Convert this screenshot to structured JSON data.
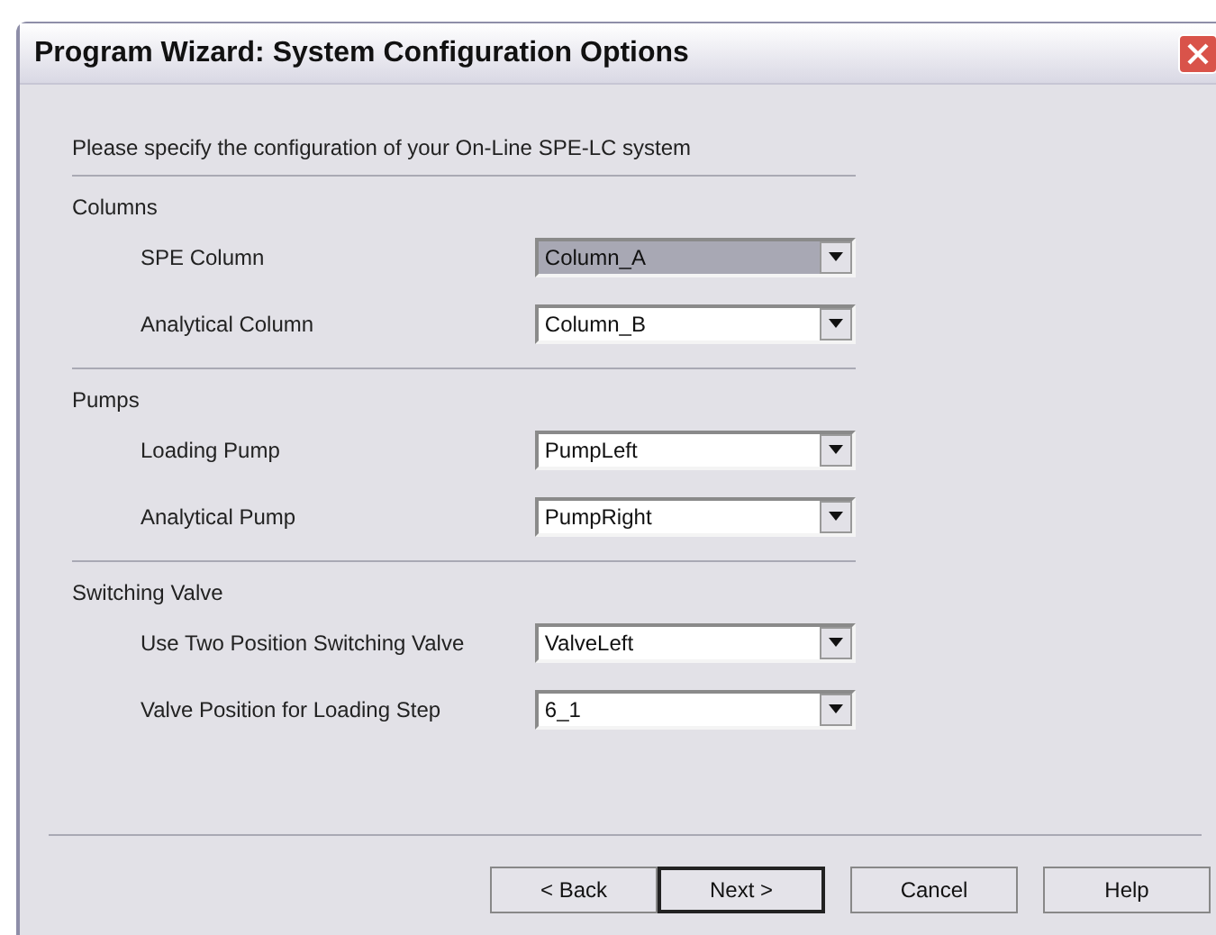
{
  "window": {
    "title": "Program Wizard: System Configuration Options"
  },
  "intro": "Please specify the configuration of your On-Line SPE-LC system",
  "sections": [
    {
      "title": "Columns",
      "fields": [
        {
          "label": "SPE Column",
          "value": "Column_A",
          "focused": true
        },
        {
          "label": "Analytical Column",
          "value": "Column_B",
          "focused": false
        }
      ]
    },
    {
      "title": "Pumps",
      "fields": [
        {
          "label": "Loading Pump",
          "value": "PumpLeft",
          "focused": false
        },
        {
          "label": "Analytical Pump",
          "value": "PumpRight",
          "focused": false
        }
      ]
    },
    {
      "title": "Switching Valve",
      "fields": [
        {
          "label": "Use Two Position Switching Valve",
          "value": "ValveLeft",
          "focused": false
        },
        {
          "label": "Valve Position for Loading Step",
          "value": "6_1",
          "focused": false
        }
      ]
    }
  ],
  "buttons": [
    {
      "label": "< Back",
      "default": false
    },
    {
      "label": "Next >",
      "default": true
    },
    {
      "label": "Cancel",
      "default": false
    },
    {
      "label": "Help",
      "default": false
    }
  ]
}
